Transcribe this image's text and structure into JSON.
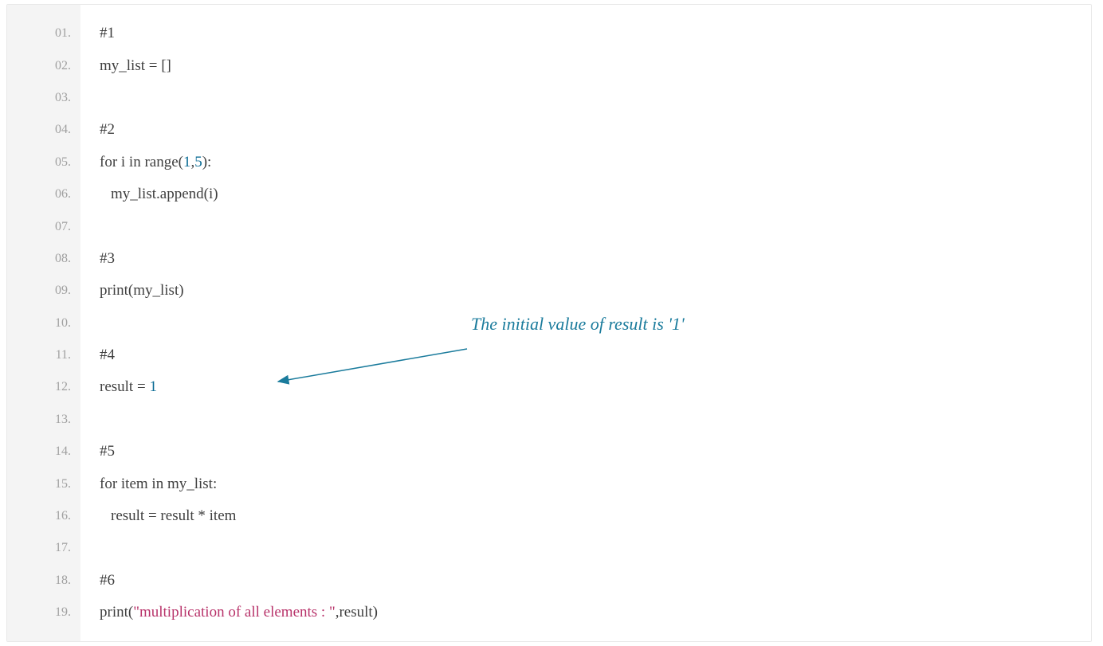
{
  "colors": {
    "gutter_bg": "#f4f4f4",
    "line_number": "#a0a0a0",
    "code_text": "#3f3f3f",
    "number_literal": "#0b6c95",
    "string_literal": "#b8336a",
    "annotation": "#1a7b9c"
  },
  "annotation": {
    "text": "The initial value of result is '1'"
  },
  "lines": [
    {
      "num": "01.",
      "indent": 0,
      "tokens": [
        {
          "t": "#1",
          "cls": "plain"
        }
      ]
    },
    {
      "num": "02.",
      "indent": 0,
      "tokens": [
        {
          "t": "my_list = []",
          "cls": "plain"
        }
      ]
    },
    {
      "num": "03.",
      "indent": 0,
      "tokens": []
    },
    {
      "num": "04.",
      "indent": 0,
      "tokens": [
        {
          "t": "#2",
          "cls": "plain"
        }
      ]
    },
    {
      "num": "05.",
      "indent": 0,
      "tokens": [
        {
          "t": "for i in range(",
          "cls": "plain"
        },
        {
          "t": "1",
          "cls": "num"
        },
        {
          "t": ",",
          "cls": "plain"
        },
        {
          "t": "5",
          "cls": "num"
        },
        {
          "t": "):",
          "cls": "plain"
        }
      ]
    },
    {
      "num": "06.",
      "indent": 1,
      "tokens": [
        {
          "t": "my_list.append(i)",
          "cls": "plain"
        }
      ]
    },
    {
      "num": "07.",
      "indent": 0,
      "tokens": []
    },
    {
      "num": "08.",
      "indent": 0,
      "tokens": [
        {
          "t": "#3",
          "cls": "plain"
        }
      ]
    },
    {
      "num": "09.",
      "indent": 0,
      "tokens": [
        {
          "t": "print(my_list)",
          "cls": "plain"
        }
      ]
    },
    {
      "num": "10.",
      "indent": 0,
      "tokens": []
    },
    {
      "num": "11.",
      "indent": 0,
      "tokens": [
        {
          "t": "#4",
          "cls": "plain"
        }
      ]
    },
    {
      "num": "12.",
      "indent": 0,
      "tokens": [
        {
          "t": "result = ",
          "cls": "plain"
        },
        {
          "t": "1",
          "cls": "num"
        }
      ]
    },
    {
      "num": "13.",
      "indent": 0,
      "tokens": []
    },
    {
      "num": "14.",
      "indent": 0,
      "tokens": [
        {
          "t": "#5",
          "cls": "plain"
        }
      ]
    },
    {
      "num": "15.",
      "indent": 0,
      "tokens": [
        {
          "t": "for item in my_list:",
          "cls": "plain"
        }
      ]
    },
    {
      "num": "16.",
      "indent": 1,
      "tokens": [
        {
          "t": "result = result * item",
          "cls": "plain"
        }
      ]
    },
    {
      "num": "17.",
      "indent": 0,
      "tokens": []
    },
    {
      "num": "18.",
      "indent": 0,
      "tokens": [
        {
          "t": "#6",
          "cls": "plain"
        }
      ]
    },
    {
      "num": "19.",
      "indent": 0,
      "tokens": [
        {
          "t": "print(",
          "cls": "plain"
        },
        {
          "t": "\"multiplication of all elements : \"",
          "cls": "str"
        },
        {
          "t": ",result)",
          "cls": "plain"
        }
      ]
    }
  ]
}
